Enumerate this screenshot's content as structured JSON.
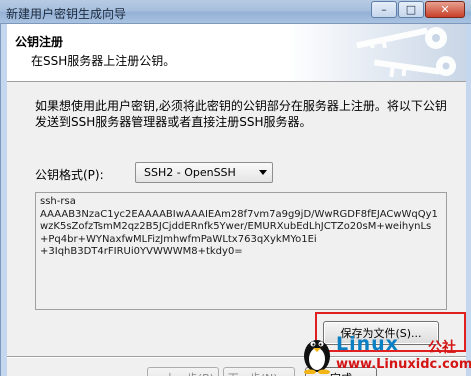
{
  "window": {
    "title": "新建用户密钥生成向导",
    "minimize_glyph": "–",
    "maximize_glyph": "□",
    "close_glyph": "✕"
  },
  "banner": {
    "heading": "公钥注册",
    "subheading": "在SSH服务器上注册公钥。"
  },
  "intro_text": "如果想使用此用户密钥,必须将此密钥的公钥部分在服务器上注册。将以下公钥发送到SSH服务器管理器或者直接注册SSH服务器。",
  "format": {
    "label": "公钥格式(P):",
    "selected": "SSH2 - OpenSSH"
  },
  "public_key_lines": [
    "ssh-rsa",
    "AAAAB3NzaC1yc2EAAAABIwAAAIEAm28f7vm7a9g9jD/WwRGDF8fEJACwWqQy1",
    "wzK5sZofzTsmM2qz2B5JCjddERnfk5Ywer/EMURXubEdLhJCTZo20sM+weihynLs",
    "+Pq4br+WYNaxfwMLFizJmhwfmPaWLtx763qXykMYo1Ei",
    "+3IqhB3DT4rFIRUi0YVWWWM8+tkdy0="
  ],
  "buttons": {
    "save_to_file": "保存为文件(S)...",
    "back": "< 上一步(B)",
    "next": "下一步(N) >",
    "finish": "完成"
  },
  "watermark": {
    "brand": "Linux",
    "brand_cn": "公社",
    "url": "www.Linuxidc.com"
  },
  "colors": {
    "highlight": "#e02020",
    "watermark_blue": "#0a7fc4",
    "watermark_red": "#d41515"
  }
}
